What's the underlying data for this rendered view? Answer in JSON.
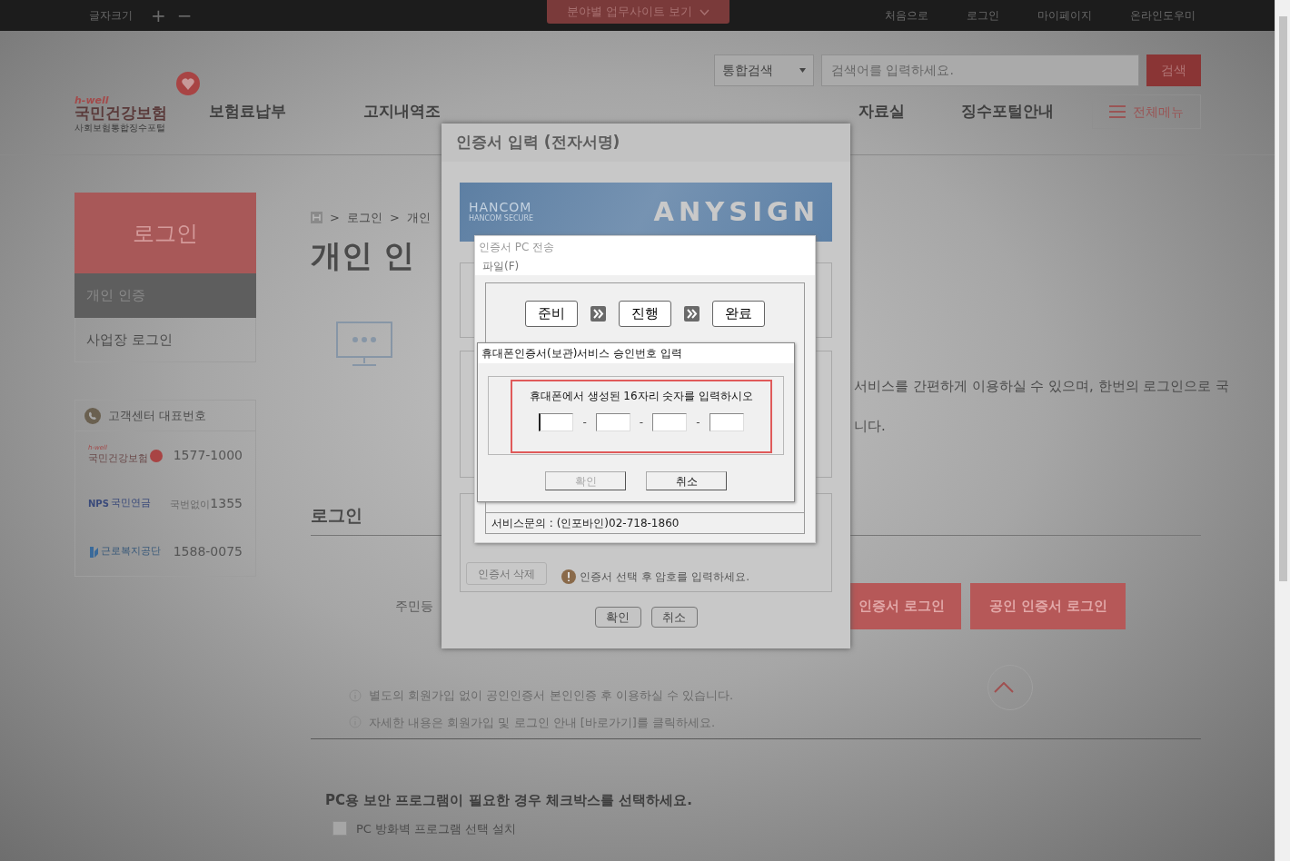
{
  "top_bar": {
    "font_size_label": "글자크기",
    "font_buttons": [
      "+",
      "−"
    ],
    "site_menu": "분야별 업무사이트 보기",
    "links": [
      "처음으로",
      "로그인",
      "마이페이지",
      "온라인도우미"
    ]
  },
  "header": {
    "logo_tag": "h-well",
    "logo_name": "국민건강보험",
    "logo_sub": "사회보험통합징수포털",
    "search": {
      "scope": "통합검색",
      "placeholder": "검색어를 입력하세요.",
      "button": "검색"
    },
    "nav": [
      "보험료납부",
      "고지내역조",
      "자료실",
      "징수포털안내"
    ],
    "all_menu": "전체메뉴"
  },
  "sidebar": {
    "title": "로그인",
    "items": [
      {
        "label": "개인 인증",
        "selected": true
      },
      {
        "label": "사업장 로그인",
        "selected": false
      }
    ],
    "contact": {
      "title": "고객센터 대표번호",
      "rows": [
        {
          "kind": "nhis",
          "tag": "h-well",
          "org": "국민건강보험",
          "number": "1577-1000"
        },
        {
          "kind": "nps",
          "tag": "NPS",
          "org": "국민연금",
          "prefix": "국번없이",
          "number": "1355"
        },
        {
          "kind": "kcomwel",
          "org": "근로복지공단",
          "number": "1588-0075"
        }
      ]
    }
  },
  "main": {
    "breadcrumb": [
      {
        "separator": ">",
        "label": "로그인"
      },
      {
        "separator": ">",
        "label": "개인"
      }
    ],
    "title": "개인 인",
    "description": [
      "서비스를 간편하게 이용하실 수 있으며, 한번의 로그인으로 국",
      "니다."
    ],
    "login_heading": "로그인",
    "id_label": "주민등",
    "login_buttons": [
      "인증서 로그인",
      "공인 인증서 로그인"
    ],
    "notes": [
      {
        "text": "별도의 회원가입 없이 공인인증서 본인인증 후 이용하실 수 있습니다."
      },
      {
        "text": "자세한 내용은 회원가입 및 로그인 안내 ",
        "link": "[바로가기]",
        "after": "를 클릭하세요."
      }
    ],
    "security_title": "PC용 보안 프로그램이 필요한 경우 체크박스를 선택하세요.",
    "security_option": {
      "label": "PC 방화벽 프로그램 선택 설치",
      "checked": false
    }
  },
  "cert_dialog": {
    "title": "인증서 입력 (전자서명)",
    "banner": {
      "brand": "HANCOM",
      "brand_sub": "HANCOM SECURE",
      "product": "ANYSIGN"
    },
    "delete_button": {
      "label": "인증서 삭제",
      "disabled": true
    },
    "hint": "인증서 선택 후 암호를 입력하세요.",
    "buttons": [
      "확인",
      "취소"
    ]
  },
  "transfer_window": {
    "title": "인증서 PC 전송",
    "menu": [
      "파일(F)"
    ],
    "steps": [
      "준비",
      "진행",
      "완료"
    ],
    "footer": "서비스문의 : (인포바인)02-718-1860"
  },
  "approval_dialog": {
    "title": "휴대폰인증서(보관)서비스 승인번호 입력",
    "instruction": "휴대폰에서 생성된 16자리 숫자를 입력하시오",
    "fields": [
      {
        "focused": true
      },
      {
        "focused": false
      },
      {
        "focused": false
      },
      {
        "focused": false
      }
    ],
    "separators": [
      "-",
      "-",
      "-"
    ],
    "buttons": [
      {
        "label": "확인",
        "disabled": true
      },
      {
        "label": "취소",
        "disabled": false
      }
    ]
  }
}
